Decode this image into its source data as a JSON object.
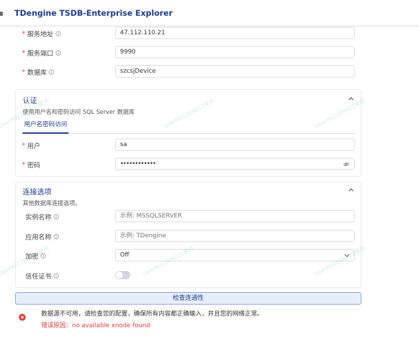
{
  "header": {
    "title": "TDengine TSDB-Enterprise Explorer"
  },
  "server": {
    "fields": [
      {
        "label": "服务地址",
        "value": "47.112.110.21"
      },
      {
        "label": "服务端口",
        "value": "9990"
      },
      {
        "label": "数据库",
        "value": "szcsjDevice"
      }
    ]
  },
  "auth": {
    "title": "认证",
    "subtitle": "使用用户名和密码访问 SQL Server 数据库",
    "tab": "用户名密码访问",
    "user": {
      "label": "用户",
      "value": "sa"
    },
    "password": {
      "label": "密码",
      "value": "••••••••••••"
    }
  },
  "connection": {
    "title": "连接选项",
    "subtitle": "其他数据库连接选项。",
    "instance": {
      "label": "实例名称",
      "placeholder": "示例: MSSQLSERVER"
    },
    "app": {
      "label": "应用名称",
      "placeholder": "示例: TDengine"
    },
    "encrypt": {
      "label": "加密",
      "value": "Off"
    },
    "trust": {
      "label": "信任证书",
      "enabled": false
    }
  },
  "actions": {
    "check_label": "检查连通性"
  },
  "error": {
    "message": "数据源不可用，请检查您的配置，确保所有内容都正确输入，并且您的网络正常。",
    "reason": "错误原因：no available xnode found"
  },
  "watermark": "UserN022EN022原页",
  "colors": {
    "accent": "#1d3a8a",
    "error": "#e03a3a",
    "border": "#d9dbe3"
  }
}
